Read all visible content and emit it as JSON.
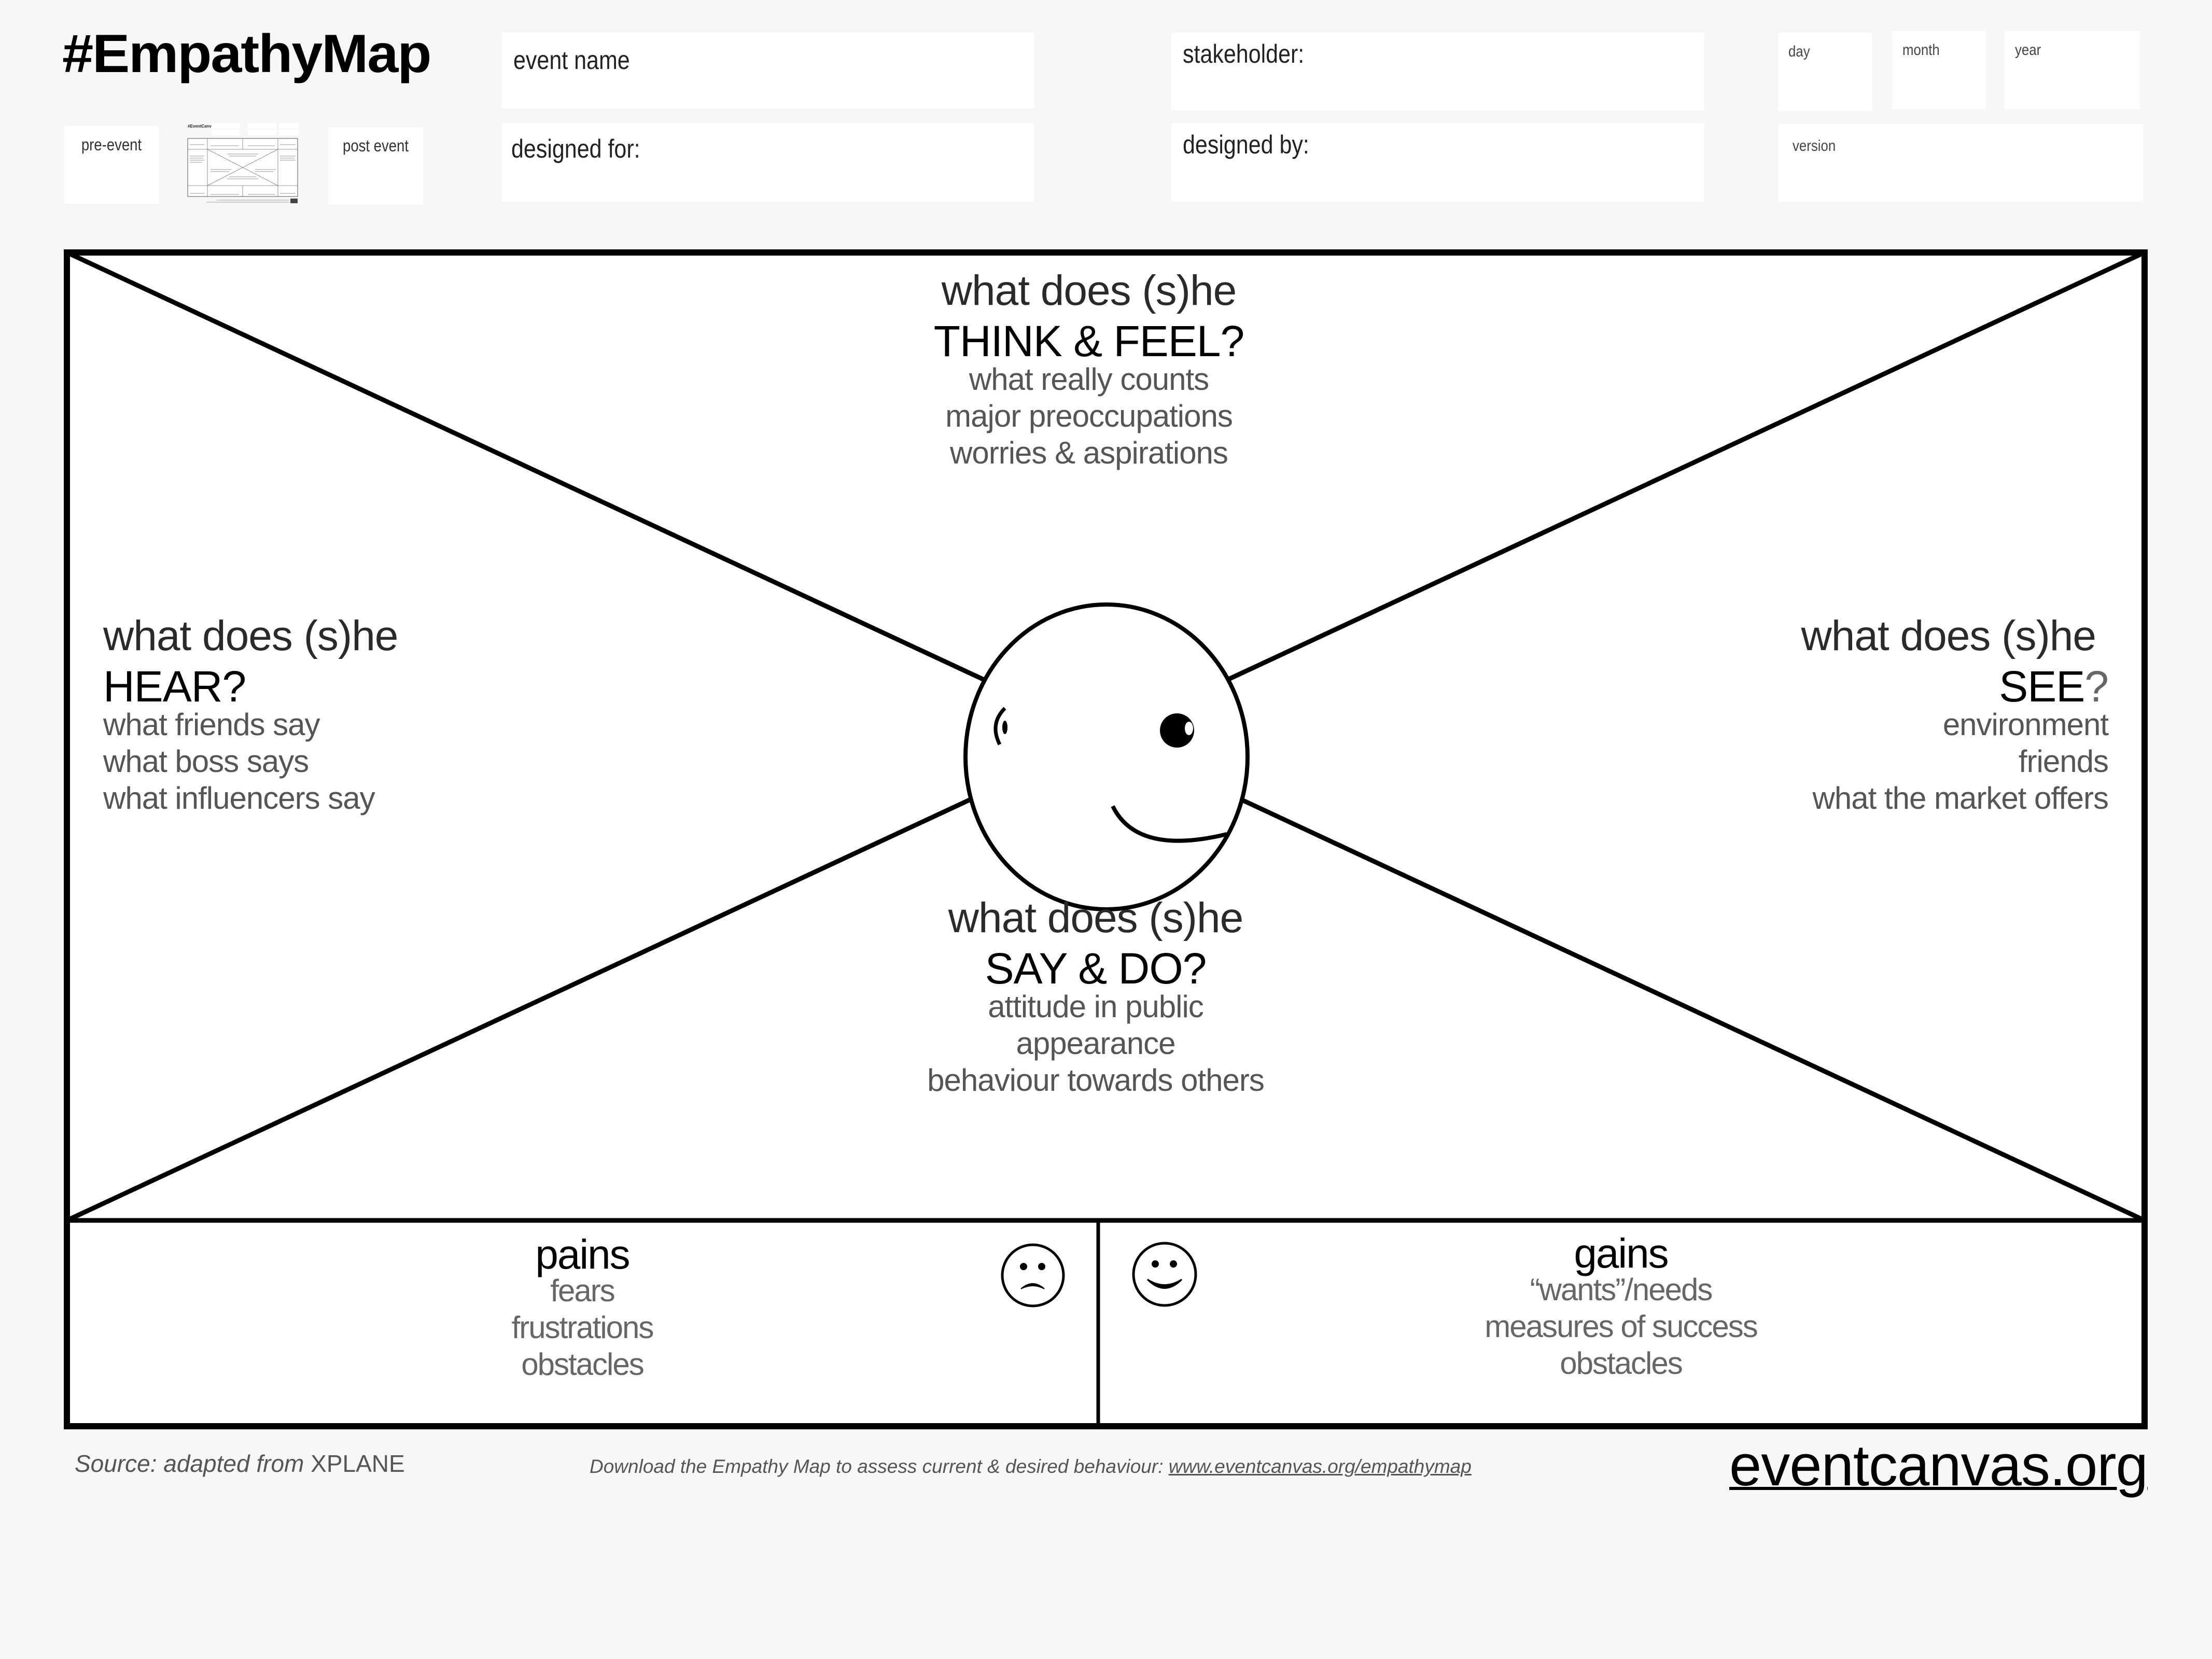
{
  "header": {
    "title": "#EmpathyMap",
    "fields": {
      "event_name": "event name",
      "designed_for": "designed for:",
      "stakeholder": "stakeholder:",
      "designed_by": "designed by:",
      "day": "day",
      "month": "month",
      "year": "year",
      "version": "version"
    },
    "phase": {
      "pre_event": "pre-event",
      "post_event": "post event",
      "thumbnail_title": "#EventCanvas"
    }
  },
  "map": {
    "think_feel": {
      "lead": "what does (s)he",
      "heading": "THINK & FEEL?",
      "items": [
        "what really counts",
        "major preoccupations",
        "worries & aspirations"
      ]
    },
    "hear": {
      "lead": "what does (s)he",
      "heading": "HEAR?",
      "items": [
        "what friends say",
        "what boss says",
        "what influencers say"
      ]
    },
    "see": {
      "lead": "what does (s)he",
      "heading": "SEE",
      "heading_mark": "?",
      "items": [
        "environment",
        "friends",
        "what the market offers"
      ]
    },
    "say_do": {
      "lead": "what does (s)he",
      "heading": "SAY & DO?",
      "items": [
        "attitude in public",
        "appearance",
        "behaviour towards others"
      ]
    },
    "pains": {
      "heading": "pains",
      "items": [
        "fears",
        "frustrations",
        "obstacles"
      ],
      "icon": "sad-face-icon"
    },
    "gains": {
      "heading": "gains",
      "items": [
        "“wants”/needs",
        "measures of success",
        "obstacles"
      ],
      "icon": "happy-face-icon"
    },
    "center_icon": "winking-face-icon"
  },
  "footer": {
    "source_prefix": "Source: adapted from",
    "source_name": "XPLANE",
    "download_text": "Download the Empathy Map to assess current & desired behaviour:",
    "download_link": "www.eventcanvas.org/empathymap",
    "brand_link": "eventcanvas.org"
  }
}
